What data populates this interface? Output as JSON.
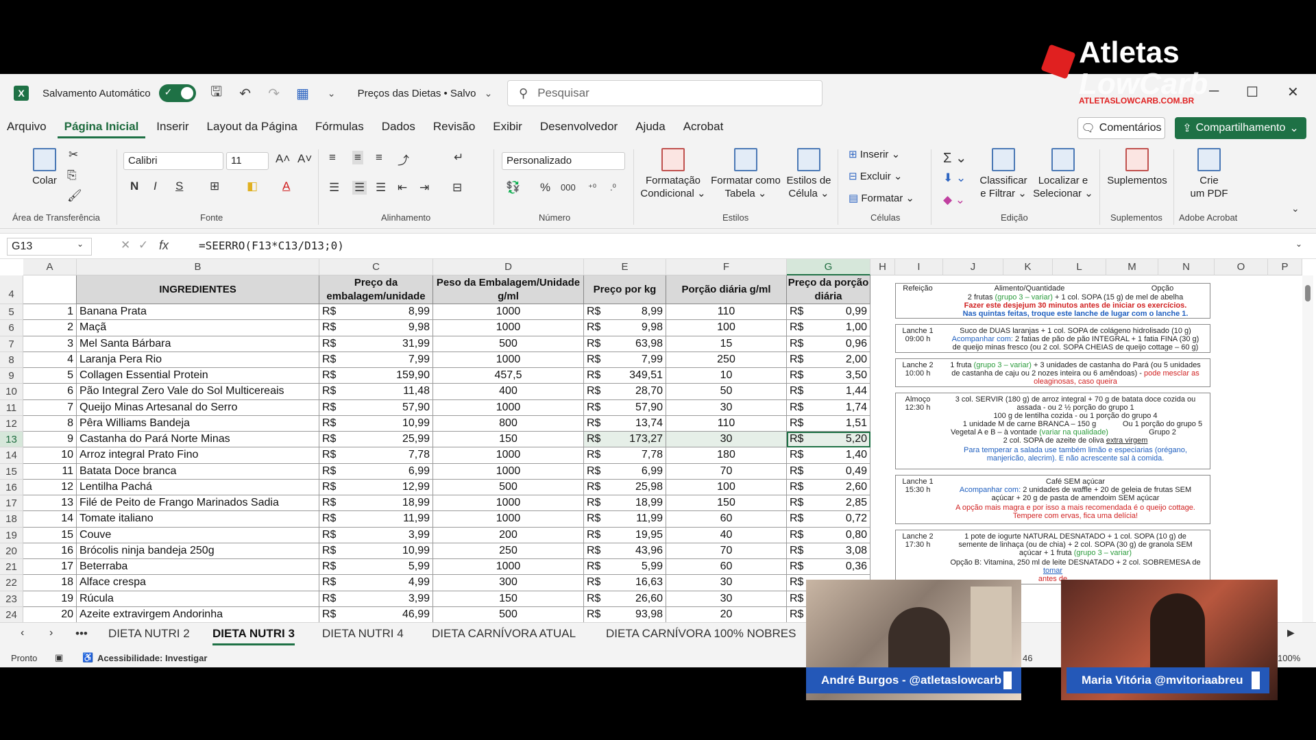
{
  "titlebar": {
    "autosave_label": "Salvamento Automático",
    "doc_title": "Preços das Dietas • Salvo",
    "search_placeholder": "Pesquisar"
  },
  "ribbon_tabs": [
    "Arquivo",
    "Página Inicial",
    "Inserir",
    "Layout da Página",
    "Fórmulas",
    "Dados",
    "Revisão",
    "Exibir",
    "Desenvolvedor",
    "Ajuda",
    "Acrobat"
  ],
  "active_tab": "Página Inicial",
  "actions": {
    "comments": "Comentários",
    "share": "Compartilhamento"
  },
  "ribbon": {
    "paste": "Colar",
    "font_name": "Calibri",
    "font_size": "11",
    "number_format": "Personalizado",
    "cond_format": [
      "Formatação",
      "Condicional"
    ],
    "format_table": [
      "Formatar como",
      "Tabela"
    ],
    "cell_styles": [
      "Estilos de",
      "Célula"
    ],
    "insert": "Inserir",
    "delete": "Excluir",
    "format": "Formatar",
    "sort_filter": [
      "Classificar",
      "e Filtrar"
    ],
    "find_select": [
      "Localizar e",
      "Selecionar"
    ],
    "addins": "Suplementos",
    "create_pdf": [
      "Crie",
      "um PDF"
    ],
    "groups": [
      "Área de Transferência",
      "Fonte",
      "Alinhamento",
      "Número",
      "Estilos",
      "Células",
      "Edição",
      "Suplementos",
      "Adobe Acrobat"
    ]
  },
  "formula_bar": {
    "name_box": "G13",
    "fx": "fx",
    "formula": "=SEERRO(F13*C13/D13;0)"
  },
  "columns": [
    "A",
    "B",
    "C",
    "D",
    "E",
    "F",
    "G",
    "H",
    "I",
    "J",
    "K",
    "L",
    "M",
    "N",
    "O",
    "P"
  ],
  "table": {
    "headers": {
      "B": "INGREDIENTES",
      "C": "Preço da embalagem/unidade",
      "D": "Peso da Embalagem/Unidade g/ml",
      "E": "Preço por kg",
      "F": "Porção diária g/ml",
      "G": "Preço da porção diária"
    },
    "currency": "R$",
    "rows": [
      {
        "row": "5",
        "n": "1",
        "name": "Banana Prata",
        "price": "8,99",
        "weight": "1000",
        "kg": "8,99",
        "portion": "110",
        "cost": "0,99"
      },
      {
        "row": "6",
        "n": "2",
        "name": "Maçã",
        "price": "9,98",
        "weight": "1000",
        "kg": "9,98",
        "portion": "100",
        "cost": "1,00"
      },
      {
        "row": "7",
        "n": "3",
        "name": "Mel Santa Bárbara",
        "price": "31,99",
        "weight": "500",
        "kg": "63,98",
        "portion": "15",
        "cost": "0,96"
      },
      {
        "row": "8",
        "n": "4",
        "name": "Laranja Pera Rio",
        "price": "7,99",
        "weight": "1000",
        "kg": "7,99",
        "portion": "250",
        "cost": "2,00"
      },
      {
        "row": "9",
        "n": "5",
        "name": "Collagen Essential Protein",
        "price": "159,90",
        "weight": "457,5",
        "kg": "349,51",
        "portion": "10",
        "cost": "3,50"
      },
      {
        "row": "10",
        "n": "6",
        "name": "Pão Integral Zero Vale do Sol Multicereais",
        "price": "11,48",
        "weight": "400",
        "kg": "28,70",
        "portion": "50",
        "cost": "1,44"
      },
      {
        "row": "11",
        "n": "7",
        "name": "Queijo Minas Artesanal do Serro",
        "price": "57,90",
        "weight": "1000",
        "kg": "57,90",
        "portion": "30",
        "cost": "1,74"
      },
      {
        "row": "12",
        "n": "8",
        "name": "Pêra Williams Bandeja",
        "price": "10,99",
        "weight": "800",
        "kg": "13,74",
        "portion": "110",
        "cost": "1,51"
      },
      {
        "row": "13",
        "n": "9",
        "name": "Castanha do Pará Norte Minas",
        "price": "25,99",
        "weight": "150",
        "kg": "173,27",
        "portion": "30",
        "cost": "5,20"
      },
      {
        "row": "14",
        "n": "10",
        "name": "Arroz integral Prato Fino",
        "price": "7,78",
        "weight": "1000",
        "kg": "7,78",
        "portion": "180",
        "cost": "1,40"
      },
      {
        "row": "15",
        "n": "11",
        "name": "Batata Doce branca",
        "price": "6,99",
        "weight": "1000",
        "kg": "6,99",
        "portion": "70",
        "cost": "0,49"
      },
      {
        "row": "16",
        "n": "12",
        "name": "Lentilha Pachá",
        "price": "12,99",
        "weight": "500",
        "kg": "25,98",
        "portion": "100",
        "cost": "2,60"
      },
      {
        "row": "17",
        "n": "13",
        "name": "Filé de Peito de Frango Marinados Sadia",
        "price": "18,99",
        "weight": "1000",
        "kg": "18,99",
        "portion": "150",
        "cost": "2,85"
      },
      {
        "row": "18",
        "n": "14",
        "name": "Tomate italiano",
        "price": "11,99",
        "weight": "1000",
        "kg": "11,99",
        "portion": "60",
        "cost": "0,72"
      },
      {
        "row": "19",
        "n": "15",
        "name": "Couve",
        "price": "3,99",
        "weight": "200",
        "kg": "19,95",
        "portion": "40",
        "cost": "0,80"
      },
      {
        "row": "20",
        "n": "16",
        "name": "Brócolis ninja bandeja 250g",
        "price": "10,99",
        "weight": "250",
        "kg": "43,96",
        "portion": "70",
        "cost": "3,08"
      },
      {
        "row": "21",
        "n": "17",
        "name": "Beterraba",
        "price": "5,99",
        "weight": "1000",
        "kg": "5,99",
        "portion": "60",
        "cost": "0,36"
      },
      {
        "row": "22",
        "n": "18",
        "name": "Alface crespa",
        "price": "4,99",
        "weight": "300",
        "kg": "16,63",
        "portion": "30",
        "cost": ""
      },
      {
        "row": "23",
        "n": "19",
        "name": "Rúcula",
        "price": "3,99",
        "weight": "150",
        "kg": "26,60",
        "portion": "30",
        "cost": ""
      },
      {
        "row": "24",
        "n": "20",
        "name": "Azeite extravirgem Andorinha",
        "price": "46,99",
        "weight": "500",
        "kg": "93,98",
        "portion": "20",
        "cost": ""
      }
    ]
  },
  "meal_plan": {
    "head": [
      "Refeição",
      "Alimento/Quantidade",
      "Opção"
    ],
    "b1": [
      "2 frutas",
      "(grupo 3 – variar)",
      "+ 1 col. SOPA (15 g) de mel de abelha",
      "Fazer este desjejum 30 minutos antes de iniciar os exercícios.",
      "Nas quintas feitas, troque este lanche de lugar com o lanche 1."
    ],
    "b2": [
      "Lanche 1",
      "09:00 h",
      "Suco de DUAS laranjas + 1 col. SOPA de colágeno hidrolisado (10 g)",
      "Acompanhar com:",
      "2 fatias de pão de pão INTEGRAL + 1 fatia FINA (30 g)",
      "de queijo minas fresco (ou 2 col. SOPA CHEIAS de queijo cottage – 60 g)"
    ],
    "b3": [
      "Lanche 2",
      "10:00 h",
      "1 fruta",
      "(grupo 3 – variar)",
      "+ 3 unidades de castanha do Pará (ou 5 unidades",
      "de castanha de caju ou 2 nozes inteira ou 6 amêndoas) -",
      "pode mesclar as",
      "oleaginosas, caso queira"
    ],
    "b4": [
      "Almoço",
      "12:30 h",
      "3 col. SERVIR (180 g) de arroz integral + 70 g de batata doce cozida ou",
      "assada - ou 2 ½ porção do grupo 1",
      "100 g de lentilha cozida - ou 1 porção do grupo 4",
      "1 unidade M de carne BRANCA – 150 g",
      "Ou 1 porção do grupo 5",
      "Vegetal A e B – à vontade",
      "(variar na qualidade)",
      "Grupo 2",
      "2 col. SOPA de azeite de oliva",
      "extra virgem",
      "Para temperar a salada use também limão e especiarias (orégano,",
      "manjericão, alecrim). E não acrescente sal à comida."
    ],
    "b5": [
      "Lanche 1",
      "15:30 h",
      "Café SEM açúcar",
      "Acompanhar com:",
      "2 unidades de waffle + 20 de geleia de frutas SEM",
      "açúcar + 20 g de pasta de amendoim SEM açúcar",
      "A opção mais magra e por isso a mais recomendada é o queijo cottage.",
      "Tempere com ervas, fica uma delícia!"
    ],
    "b6": [
      "Lanche 2",
      "17:30 h",
      "1 pote de iogurte NATURAL DESNATADO + 1 col. SOPA (10 g) de",
      "semente de linhaça (ou de chia) + 2 col. SOPA (30 g) de granola SEM",
      "açúcar + 1 fruta",
      "(grupo 3 – variar)",
      "Opção B: Vitamina, 250 ml de leite DESNATADO + 2 col. SOBREMESA de",
      "tomar",
      "antes de"
    ]
  },
  "sheet_tabs": [
    "DIETA NUTRI 2",
    "DIETA NUTRI 3",
    "DIETA NUTRI 4",
    "DIETA CARNÍVORA ATUAL",
    "DIETA CARNÍVORA 100% NOBRES"
  ],
  "active_sheet": "DIETA NUTRI 3",
  "status": {
    "ready": "Pronto",
    "accessibility": "Acessibilidade: Investigar",
    "count": "46",
    "zoom": "100%"
  },
  "overlay": {
    "brand_line1": "Atletas",
    "brand_line2": "LowCarb",
    "brand_url": "ATLETASLOWCARB.COM.BR",
    "cam1_label": "André Burgos - @atletaslowcarb",
    "cam2_label": "Maria Vitória @mvitoriaabreu"
  },
  "colors": {
    "excel_green": "#1e7145",
    "header_gray": "#d9d9d9",
    "cam_label_blue": "#2458b8",
    "brand_red": "#e02020"
  }
}
